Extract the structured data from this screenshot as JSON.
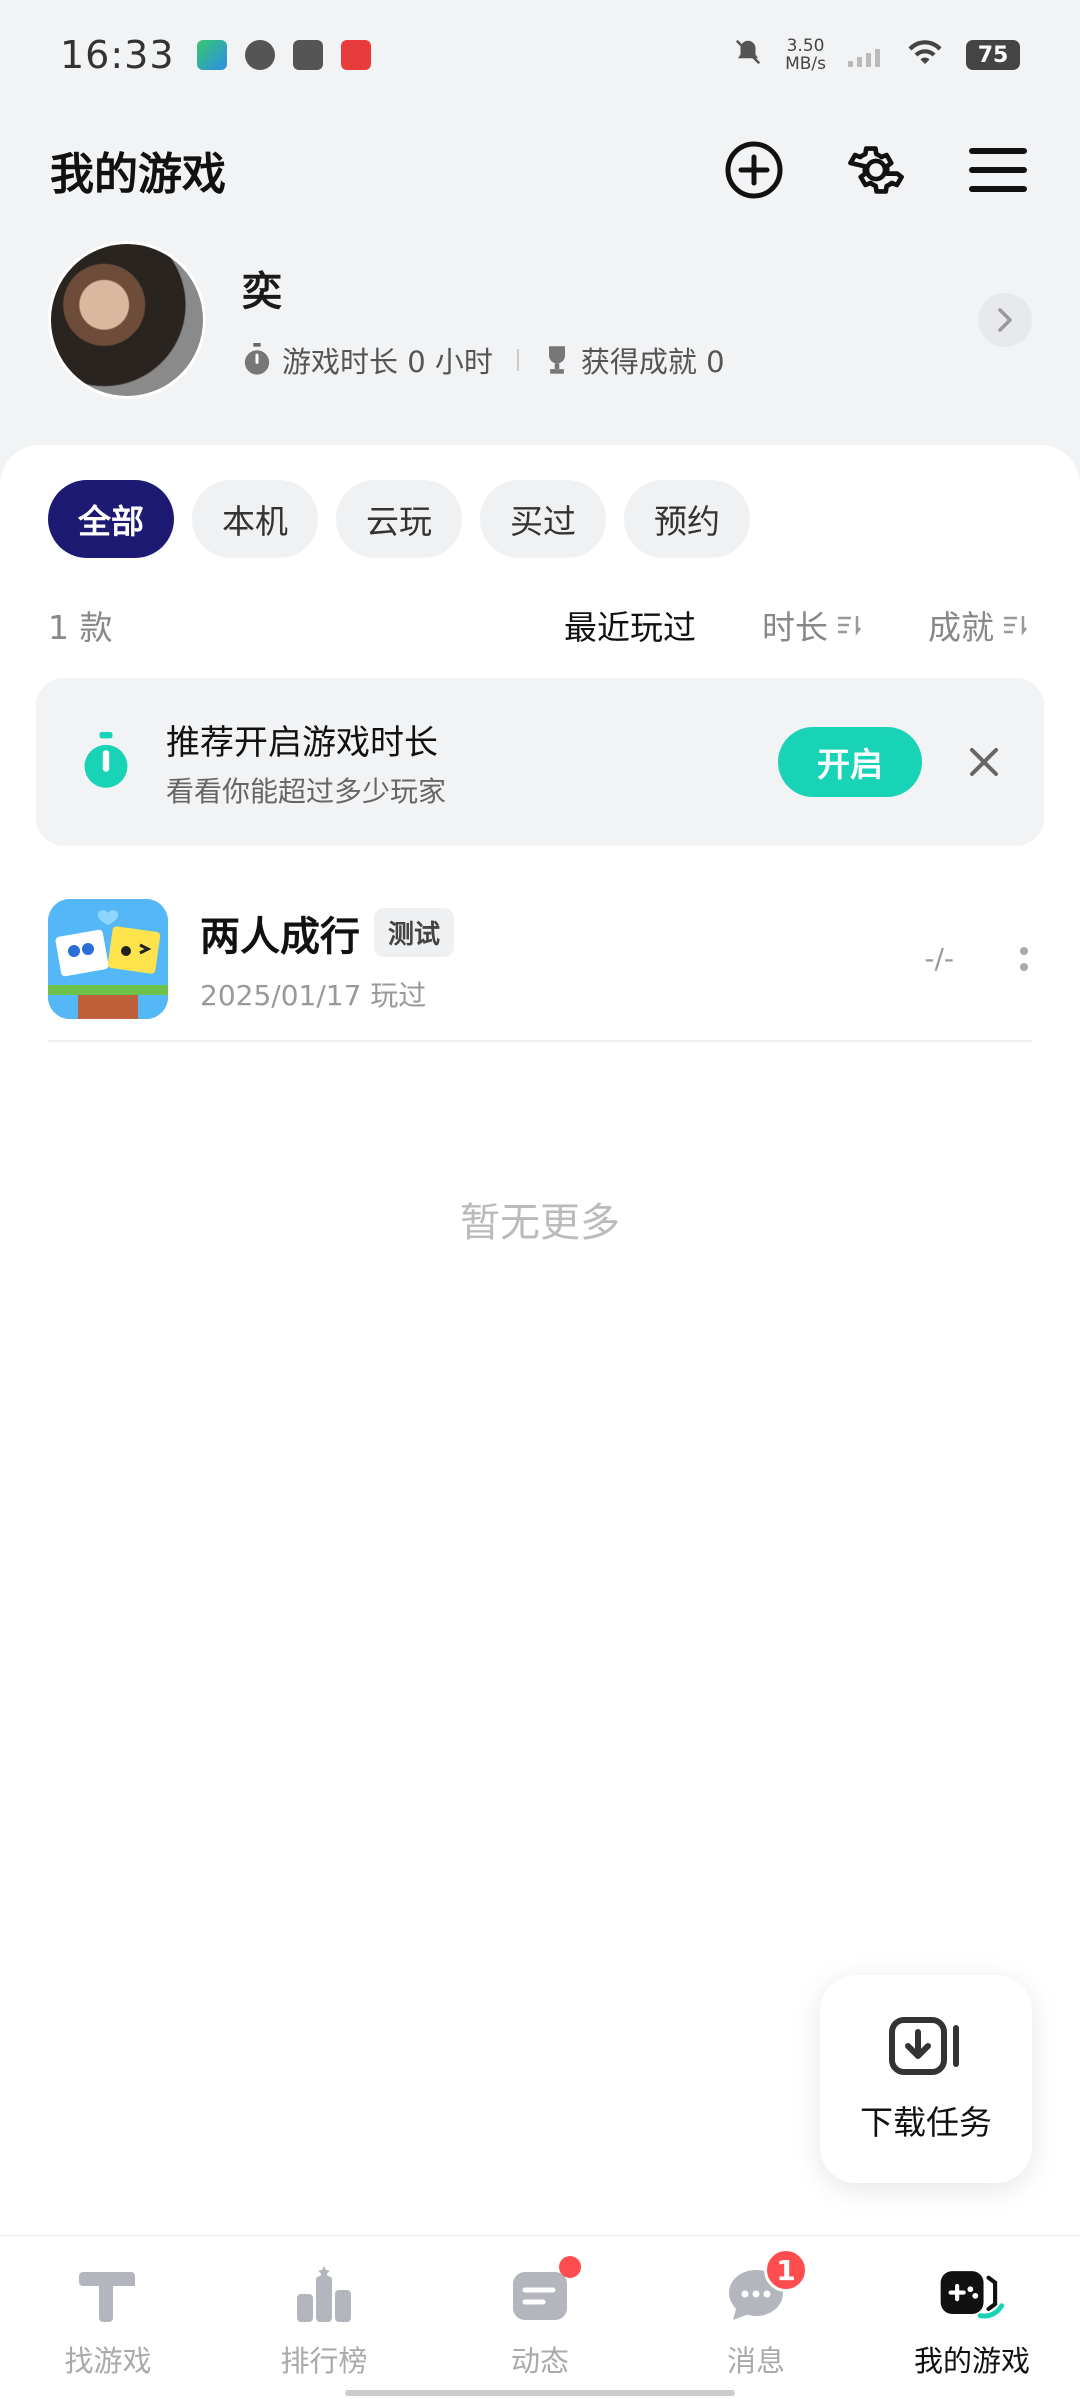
{
  "status_bar": {
    "time": "16:33",
    "net_speed_value": "3.50",
    "net_speed_unit": "MB/s",
    "battery": "75"
  },
  "header": {
    "title": "我的游戏"
  },
  "profile": {
    "name": "奕",
    "play_time": "游戏时长 0 小时",
    "achievements": "获得成就 0"
  },
  "filters": {
    "tabs": [
      "全部",
      "本机",
      "云玩",
      "买过",
      "预约"
    ],
    "active_index": 0
  },
  "sort": {
    "count": "1 款",
    "options": [
      "最近玩过",
      "时长",
      "成就"
    ]
  },
  "promo": {
    "title": "推荐开启游戏时长",
    "subtitle": "看看你能超过多少玩家",
    "button": "开启"
  },
  "games": [
    {
      "title": "两人成行",
      "tag": "测试",
      "last_played": "2025/01/17 玩过",
      "play_time": "-/-"
    }
  ],
  "empty_note": "暂无更多",
  "download_fab": {
    "label": "下载任务"
  },
  "bottom_nav": {
    "items": [
      "找游戏",
      "排行榜",
      "动态",
      "消息",
      "我的游戏"
    ],
    "messages_badge": "1",
    "active_index": 4
  },
  "colors": {
    "accent": "#19d3b6",
    "active_chip": "#1c1a72",
    "badge": "#ff4d4f"
  }
}
